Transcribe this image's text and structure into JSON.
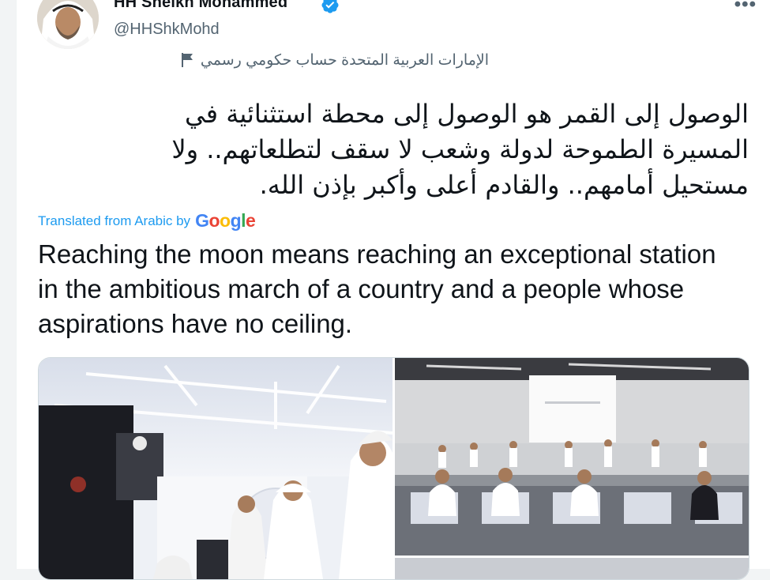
{
  "tweet": {
    "display_name": "HH Sheikh Mohammed",
    "handle": "@HHShkMohd",
    "more_menu": "•••",
    "account_label": "الإمارات العربية المتحدة حساب حكومي رسمي",
    "arabic_text": "الوصول إلى القمر هو الوصول إلى محطة استثنائية في المسيرة الطموحة لدولة وشعب لا سقف لتطلعاتهم.. ولا مستحيل أمامهم.. والقادم أعلى وأكبر بإذن الله.",
    "translated_prefix": "Translated from Arabic by",
    "translator": "Google",
    "english_text": "Reaching the moon means reaching an exceptional station in the ambitious march of a country and a people whose aspirations have no ceiling."
  },
  "icons": {
    "verified": "verified-badge-icon",
    "flag": "flag-icon",
    "more": "more-icon"
  },
  "colors": {
    "link_blue": "#1d9bf0",
    "secondary_text": "#536471",
    "primary_text": "#0f1419"
  }
}
